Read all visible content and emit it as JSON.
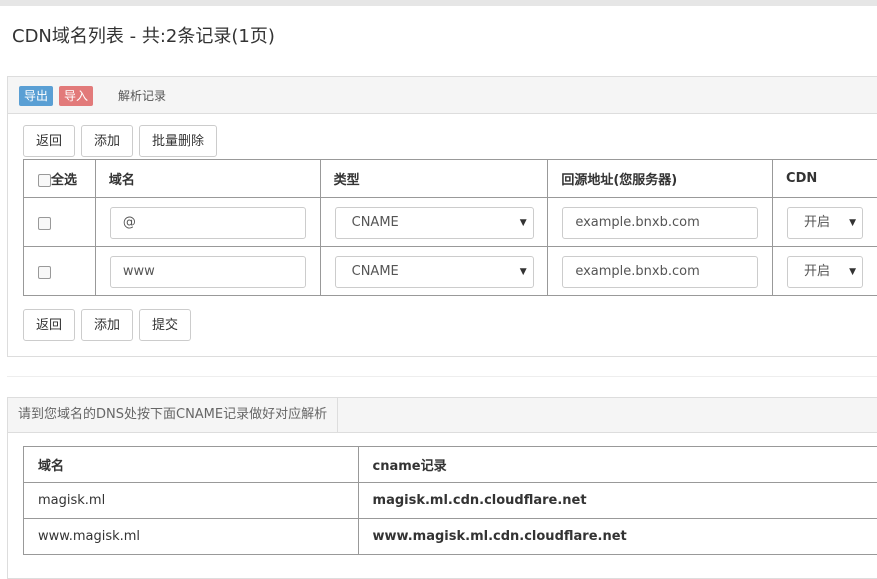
{
  "page_title": "CDN域名列表 - 共:2条记录(1页)",
  "panel1": {
    "export_label": "导出",
    "import_label": "导入",
    "header_label": "解析记录",
    "top_buttons": {
      "back": "返回",
      "add": "添加",
      "batch_delete": "批量删除"
    },
    "bottom_buttons": {
      "back": "返回",
      "add": "添加",
      "submit": "提交"
    },
    "columns": {
      "select_all": "全选",
      "domain": "域名",
      "type": "类型",
      "origin": "回源地址(您服务器)",
      "cdn": "CDN"
    },
    "rows": [
      {
        "domain": "@",
        "type": "CNAME",
        "origin": "example.bnxb.com",
        "cdn": "开启"
      },
      {
        "domain": "www",
        "type": "CNAME",
        "origin": "example.bnxb.com",
        "cdn": "开启"
      }
    ]
  },
  "panel2": {
    "header_label": "请到您域名的DNS处按下面CNAME记录做好对应解析",
    "columns": {
      "domain": "域名",
      "cname": "cname记录"
    },
    "rows": [
      {
        "domain": "magisk.ml",
        "cname": "magisk.ml.cdn.cloudflare.net"
      },
      {
        "domain": "www.magisk.ml",
        "cname": "www.magisk.ml.cdn.cloudflare.net"
      }
    ]
  },
  "colors": {
    "export_tag": "#5a9fd4",
    "import_tag": "#e27a7a"
  }
}
